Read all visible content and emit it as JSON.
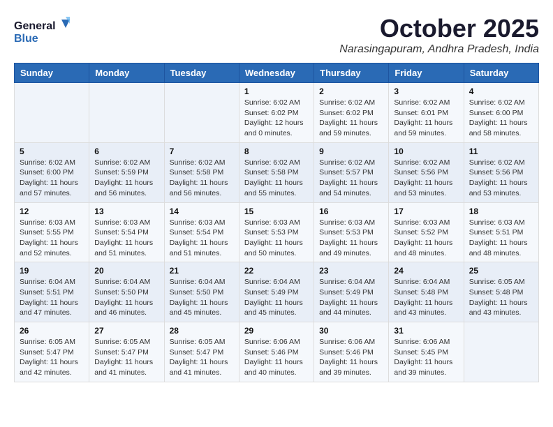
{
  "header": {
    "logo_line1": "General",
    "logo_line2": "Blue",
    "month": "October 2025",
    "location": "Narasingapuram, Andhra Pradesh, India"
  },
  "weekdays": [
    "Sunday",
    "Monday",
    "Tuesday",
    "Wednesday",
    "Thursday",
    "Friday",
    "Saturday"
  ],
  "weeks": [
    [
      {
        "day": "",
        "info": ""
      },
      {
        "day": "",
        "info": ""
      },
      {
        "day": "",
        "info": ""
      },
      {
        "day": "1",
        "info": "Sunrise: 6:02 AM\nSunset: 6:02 PM\nDaylight: 12 hours\nand 0 minutes."
      },
      {
        "day": "2",
        "info": "Sunrise: 6:02 AM\nSunset: 6:02 PM\nDaylight: 11 hours\nand 59 minutes."
      },
      {
        "day": "3",
        "info": "Sunrise: 6:02 AM\nSunset: 6:01 PM\nDaylight: 11 hours\nand 59 minutes."
      },
      {
        "day": "4",
        "info": "Sunrise: 6:02 AM\nSunset: 6:00 PM\nDaylight: 11 hours\nand 58 minutes."
      }
    ],
    [
      {
        "day": "5",
        "info": "Sunrise: 6:02 AM\nSunset: 6:00 PM\nDaylight: 11 hours\nand 57 minutes."
      },
      {
        "day": "6",
        "info": "Sunrise: 6:02 AM\nSunset: 5:59 PM\nDaylight: 11 hours\nand 56 minutes."
      },
      {
        "day": "7",
        "info": "Sunrise: 6:02 AM\nSunset: 5:58 PM\nDaylight: 11 hours\nand 56 minutes."
      },
      {
        "day": "8",
        "info": "Sunrise: 6:02 AM\nSunset: 5:58 PM\nDaylight: 11 hours\nand 55 minutes."
      },
      {
        "day": "9",
        "info": "Sunrise: 6:02 AM\nSunset: 5:57 PM\nDaylight: 11 hours\nand 54 minutes."
      },
      {
        "day": "10",
        "info": "Sunrise: 6:02 AM\nSunset: 5:56 PM\nDaylight: 11 hours\nand 53 minutes."
      },
      {
        "day": "11",
        "info": "Sunrise: 6:02 AM\nSunset: 5:56 PM\nDaylight: 11 hours\nand 53 minutes."
      }
    ],
    [
      {
        "day": "12",
        "info": "Sunrise: 6:03 AM\nSunset: 5:55 PM\nDaylight: 11 hours\nand 52 minutes."
      },
      {
        "day": "13",
        "info": "Sunrise: 6:03 AM\nSunset: 5:54 PM\nDaylight: 11 hours\nand 51 minutes."
      },
      {
        "day": "14",
        "info": "Sunrise: 6:03 AM\nSunset: 5:54 PM\nDaylight: 11 hours\nand 51 minutes."
      },
      {
        "day": "15",
        "info": "Sunrise: 6:03 AM\nSunset: 5:53 PM\nDaylight: 11 hours\nand 50 minutes."
      },
      {
        "day": "16",
        "info": "Sunrise: 6:03 AM\nSunset: 5:53 PM\nDaylight: 11 hours\nand 49 minutes."
      },
      {
        "day": "17",
        "info": "Sunrise: 6:03 AM\nSunset: 5:52 PM\nDaylight: 11 hours\nand 48 minutes."
      },
      {
        "day": "18",
        "info": "Sunrise: 6:03 AM\nSunset: 5:51 PM\nDaylight: 11 hours\nand 48 minutes."
      }
    ],
    [
      {
        "day": "19",
        "info": "Sunrise: 6:04 AM\nSunset: 5:51 PM\nDaylight: 11 hours\nand 47 minutes."
      },
      {
        "day": "20",
        "info": "Sunrise: 6:04 AM\nSunset: 5:50 PM\nDaylight: 11 hours\nand 46 minutes."
      },
      {
        "day": "21",
        "info": "Sunrise: 6:04 AM\nSunset: 5:50 PM\nDaylight: 11 hours\nand 45 minutes."
      },
      {
        "day": "22",
        "info": "Sunrise: 6:04 AM\nSunset: 5:49 PM\nDaylight: 11 hours\nand 45 minutes."
      },
      {
        "day": "23",
        "info": "Sunrise: 6:04 AM\nSunset: 5:49 PM\nDaylight: 11 hours\nand 44 minutes."
      },
      {
        "day": "24",
        "info": "Sunrise: 6:04 AM\nSunset: 5:48 PM\nDaylight: 11 hours\nand 43 minutes."
      },
      {
        "day": "25",
        "info": "Sunrise: 6:05 AM\nSunset: 5:48 PM\nDaylight: 11 hours\nand 43 minutes."
      }
    ],
    [
      {
        "day": "26",
        "info": "Sunrise: 6:05 AM\nSunset: 5:47 PM\nDaylight: 11 hours\nand 42 minutes."
      },
      {
        "day": "27",
        "info": "Sunrise: 6:05 AM\nSunset: 5:47 PM\nDaylight: 11 hours\nand 41 minutes."
      },
      {
        "day": "28",
        "info": "Sunrise: 6:05 AM\nSunset: 5:47 PM\nDaylight: 11 hours\nand 41 minutes."
      },
      {
        "day": "29",
        "info": "Sunrise: 6:06 AM\nSunset: 5:46 PM\nDaylight: 11 hours\nand 40 minutes."
      },
      {
        "day": "30",
        "info": "Sunrise: 6:06 AM\nSunset: 5:46 PM\nDaylight: 11 hours\nand 39 minutes."
      },
      {
        "day": "31",
        "info": "Sunrise: 6:06 AM\nSunset: 5:45 PM\nDaylight: 11 hours\nand 39 minutes."
      },
      {
        "day": "",
        "info": ""
      }
    ]
  ]
}
